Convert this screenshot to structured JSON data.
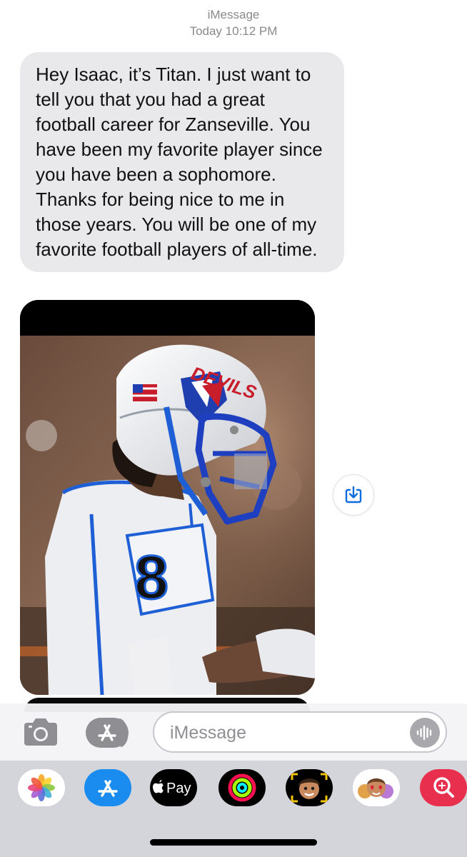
{
  "header": {
    "service": "iMessage",
    "timestamp": "Today 10:12 PM"
  },
  "message": {
    "text": "Hey Isaac, it’s Titan. I just want to tell you that you had a great football career for Zanseville. You have been my favorite player since you have been a sophomore. Thanks for being nice to me in those years. You will be one of my favorite football players of all-time."
  },
  "photo": {
    "jersey_number": "8",
    "helmet_text": "DEVILS"
  },
  "composer": {
    "placeholder": "iMessage"
  },
  "tray": {
    "items": [
      {
        "icon": "photos-icon"
      },
      {
        "icon": "app-store-icon"
      },
      {
        "icon": "apple-pay-icon",
        "label": "Pay"
      },
      {
        "icon": "activity-icon"
      },
      {
        "icon": "memoji-icon"
      },
      {
        "icon": "memoji-stickers-icon"
      },
      {
        "icon": "image-search-icon"
      }
    ]
  },
  "colors": {
    "bubble": "#e9e9eb",
    "accent": "#0a6cdf",
    "tray": "#d3d5db"
  }
}
